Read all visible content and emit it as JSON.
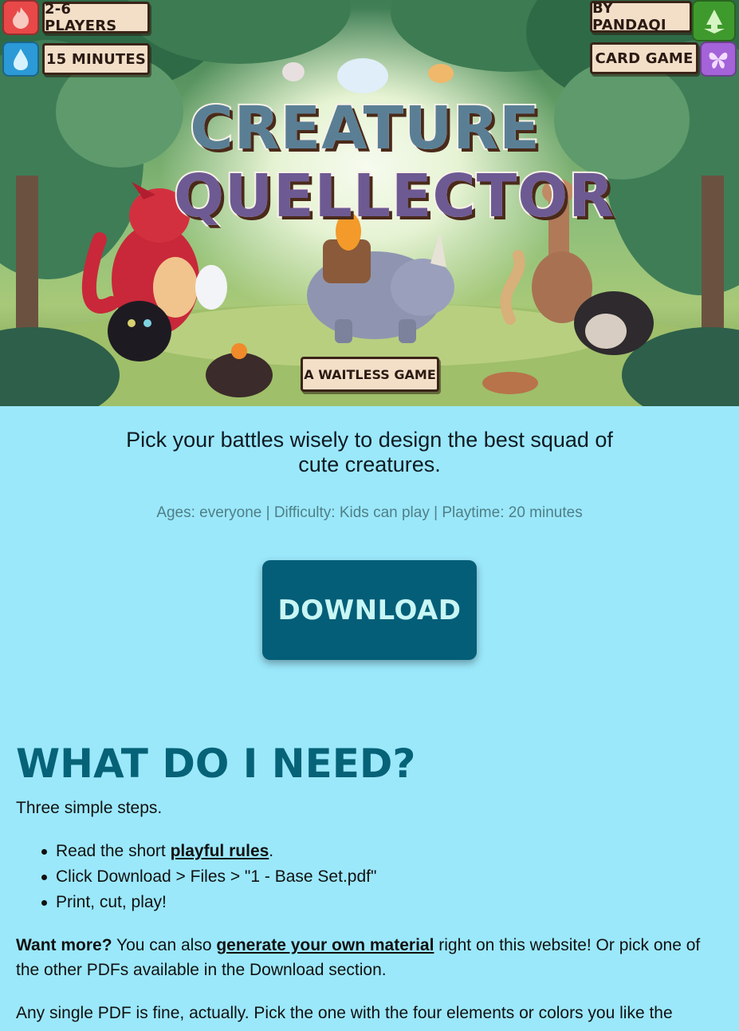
{
  "hero": {
    "badges": {
      "players": "2-6 PLAYERS",
      "minutes": "15 MINUTES",
      "author": "BY PANDAQI",
      "type": "CARD GAME"
    },
    "icons": [
      "fire-icon",
      "water-drop-icon",
      "arrow-down-icon",
      "butterfly-icon"
    ],
    "title_line1": "CREATURE",
    "title_line2": "QUELLECTOR",
    "subtitle_badge": "A WAITLESS GAME"
  },
  "tagline": "Pick your battles wisely to design the best squad of cute creatures.",
  "meta": "Ages: everyone | Difficulty: Kids can play | Playtime: 20 minutes",
  "download_label": "DOWNLOAD",
  "need": {
    "heading": "WHAT DO I NEED?",
    "intro": "Three simple steps.",
    "step1_prefix": "Read the short ",
    "step1_link": "playful rules",
    "step1_suffix": ".",
    "step2": "Click Download > Files > \"1 - Base Set.pdf\"",
    "step3": "Print, cut, play!",
    "more_bold": "Want more?",
    "more_prefix": " You can also ",
    "more_link": "generate your own material",
    "more_suffix": " right on this website! Or pick one of the other PDFs available in the Download section.",
    "single_pdf": "Any single PDF is fine, actually. Pick the one with the four elements or colors you like the"
  },
  "colors": {
    "background": "#9be8fb",
    "button": "#045e78",
    "button_text": "#c8f6f5",
    "heading": "#066277",
    "meta_text": "#4f7f86"
  }
}
